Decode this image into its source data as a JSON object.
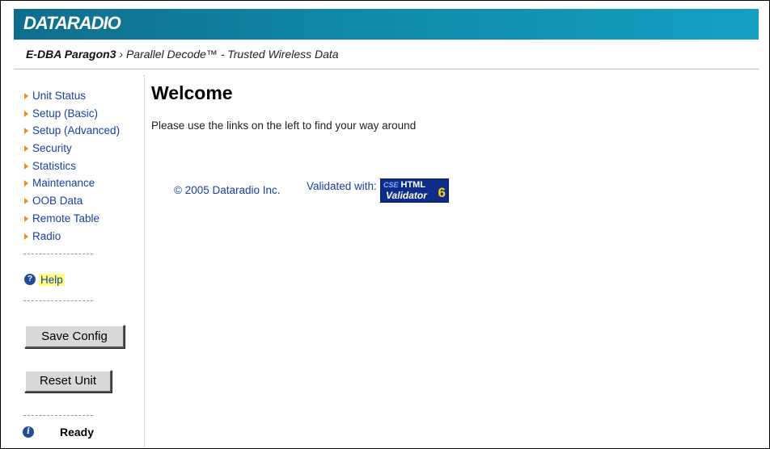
{
  "header": {
    "logo_text": "DATARADIO",
    "product_name": "E-DBA Paragon3",
    "separator": " › ",
    "tagline": "Parallel Decode™ - Trusted Wireless Data"
  },
  "sidebar": {
    "items": [
      {
        "label": "Unit Status"
      },
      {
        "label": "Setup (Basic)"
      },
      {
        "label": "Setup (Advanced)"
      },
      {
        "label": "Security"
      },
      {
        "label": "Statistics"
      },
      {
        "label": "Maintenance"
      },
      {
        "label": "OOB Data"
      },
      {
        "label": "Remote Table"
      },
      {
        "label": "Radio"
      }
    ],
    "help": {
      "label": "Help",
      "icon": "question-icon"
    },
    "save_label": "Save Config",
    "reset_label": "Reset Unit",
    "status": {
      "icon": "info-icon",
      "text": "Ready"
    }
  },
  "main": {
    "title": "Welcome",
    "intro": "Please use the links on the left to find your way around",
    "copyright": "© 2005 Dataradio Inc.",
    "validated_label": "Validated with:",
    "badge": {
      "brand": "CSE",
      "line1": "HTML",
      "line2": "Validator",
      "version": "6"
    }
  },
  "colors": {
    "banner": "#1188a8",
    "link": "#1a3ea8",
    "nav_arrow": "#f08a1c",
    "help_highlight": "#ffff80"
  }
}
